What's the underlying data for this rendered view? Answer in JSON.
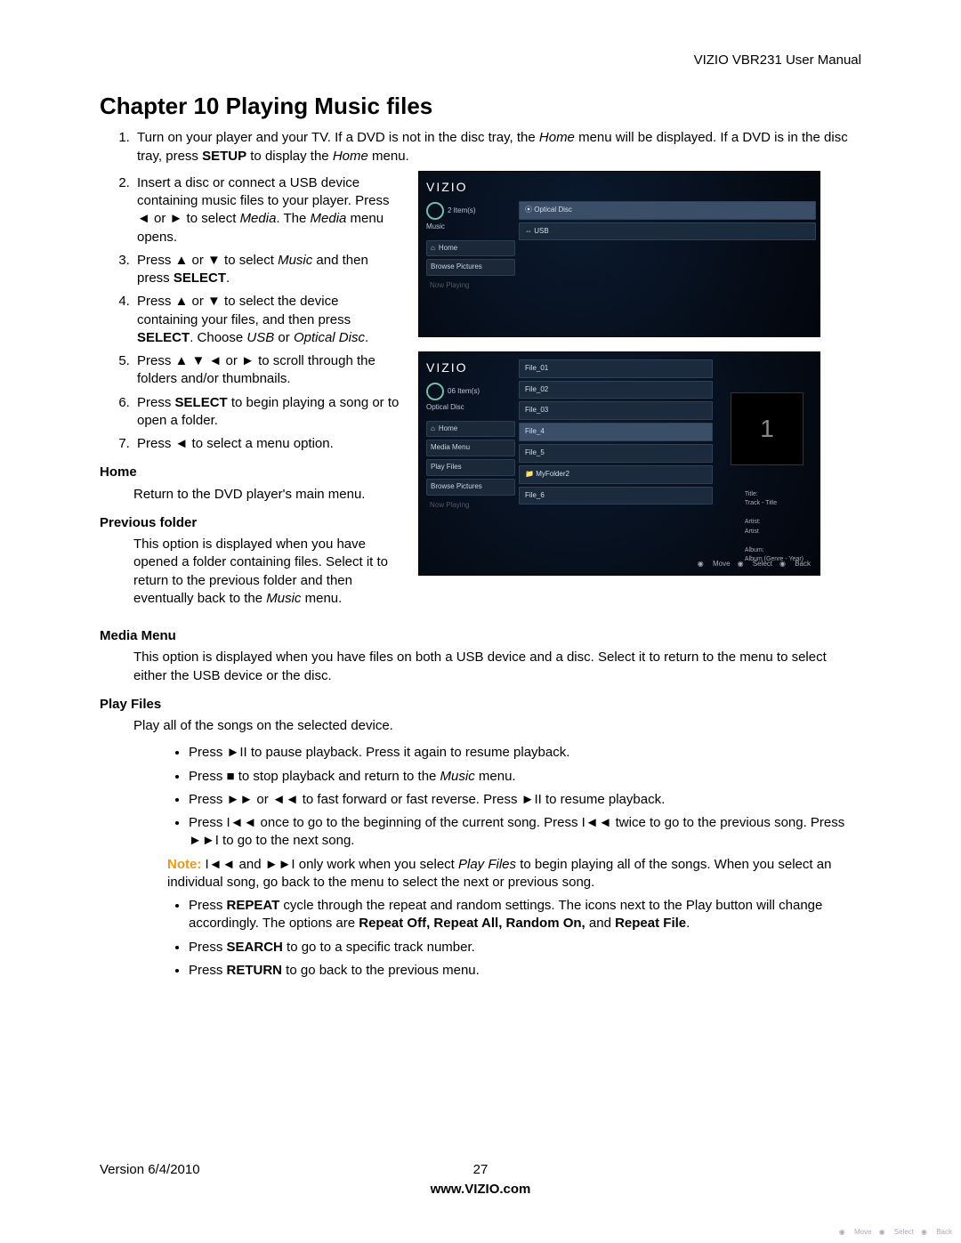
{
  "header": "VIZIO VBR231 User Manual",
  "title": "Chapter 10 Playing Music files",
  "steps": {
    "s1a": "Turn on your player and your TV. If a DVD is not in the disc tray, the ",
    "s1b": "Home",
    "s1c": " menu will be displayed. If a DVD is in the disc tray, press ",
    "s1d": "SETUP",
    "s1e": " to display the ",
    "s1f": "Home",
    "s1g": " menu.",
    "s2a": "Insert a disc or connect a USB device containing music files to your player. Press ◄ or ► to select ",
    "s2b": "Media",
    "s2c": ". The ",
    "s2d": "Media",
    "s2e": " menu opens.",
    "s3a": "Press ▲ or ▼ to select ",
    "s3b": "Music",
    "s3c": " and then press ",
    "s3d": "SELECT",
    "s3e": ".",
    "s4a": "Press ▲ or ▼ to select the device containing your files, and then press ",
    "s4b": "SELECT",
    "s4c": ". Choose ",
    "s4d": "USB",
    "s4e": " or ",
    "s4f": "Optical Disc",
    "s4g": ".",
    "s5": "Press ▲ ▼ ◄ or ► to scroll through the folders and/or thumbnails.",
    "s6a": "Press ",
    "s6b": "SELECT",
    "s6c": " to begin playing a song or to open a folder.",
    "s7": "Press ◄ to select a menu option."
  },
  "sections": {
    "home": {
      "h": "Home",
      "p": "Return to the DVD player's main menu."
    },
    "prev": {
      "h": "Previous folder",
      "p1": "This option is displayed when you have opened a folder containing files. Select it to return to the previous folder and then eventually back to the ",
      "p2": "Music",
      "p3": " menu."
    },
    "media": {
      "h": "Media Menu",
      "p": "This option is displayed when you have files on both a USB device and a disc. Select it to return to the menu to select either the USB device or the disc."
    },
    "play": {
      "h": "Play Files",
      "intro": "Play all of the songs on the selected device."
    }
  },
  "bullets": {
    "b1": "Press ►II to pause playback. Press it again to resume playback.",
    "b2a": "Press ■ to stop playback and return to the ",
    "b2b": "Music",
    "b2c": " menu.",
    "b3": "Press ►► or ◄◄ to fast forward or fast reverse. Press ►II to resume playback.",
    "b4": "Press I◄◄ once to go to the beginning of the current song. Press I◄◄ twice to go to the previous song. Press ►►I to go to the next song.",
    "noteL": "Note:",
    "note1": " I◄◄ and ►►I only work when you select ",
    "note2": "Play Files",
    "note3": " to begin playing all of the songs. When you select an individual song, go back to the menu to select the next or previous song.",
    "b5a": "Press ",
    "b5b": "REPEAT",
    "b5c": " cycle through the repeat and random settings. The icons next to the Play button will change accordingly. The options are ",
    "b5d": "Repeat Off, Repeat All, Random On,",
    "b5e": " and ",
    "b5f": "Repeat File",
    "b5g": ".",
    "b6a": "Press ",
    "b6b": "SEARCH",
    "b6c": " to go to a specific track number.",
    "b7a": "Press ",
    "b7b": "RETURN",
    "b7c": " to go back to the previous menu."
  },
  "footer": {
    "version": "Version 6/4/2010",
    "page": "27",
    "url": "www.VIZIO.com"
  },
  "shot1": {
    "logo": "VIZIO",
    "count": "2 Item(s)",
    "label": "Music",
    "side": [
      "Home",
      "Browse Pictures",
      "Now Playing"
    ],
    "rows": [
      "Optical Disc",
      "USB"
    ],
    "prompts": {
      "move": "Move",
      "select": "Select",
      "back": "Back"
    }
  },
  "shot2": {
    "logo": "VIZIO",
    "count": "06 Item(s)",
    "label": "Optical Disc",
    "side": [
      "Home",
      "Media Menu",
      "Play Files",
      "Browse Pictures",
      "Now Playing"
    ],
    "rows": [
      "File_01",
      "File_02",
      "File_03",
      "File_4",
      "File_5",
      "MyFolder2",
      "File_6"
    ],
    "thumb": "1",
    "meta": {
      "title": "Title:",
      "titlev": "Track - Title",
      "artist": "Artist:",
      "artistv": "Artist",
      "album": "Album:",
      "albumv": "Album (Genre - Year)"
    },
    "prompts": {
      "move": "Move",
      "select": "Select",
      "back": "Back"
    }
  }
}
